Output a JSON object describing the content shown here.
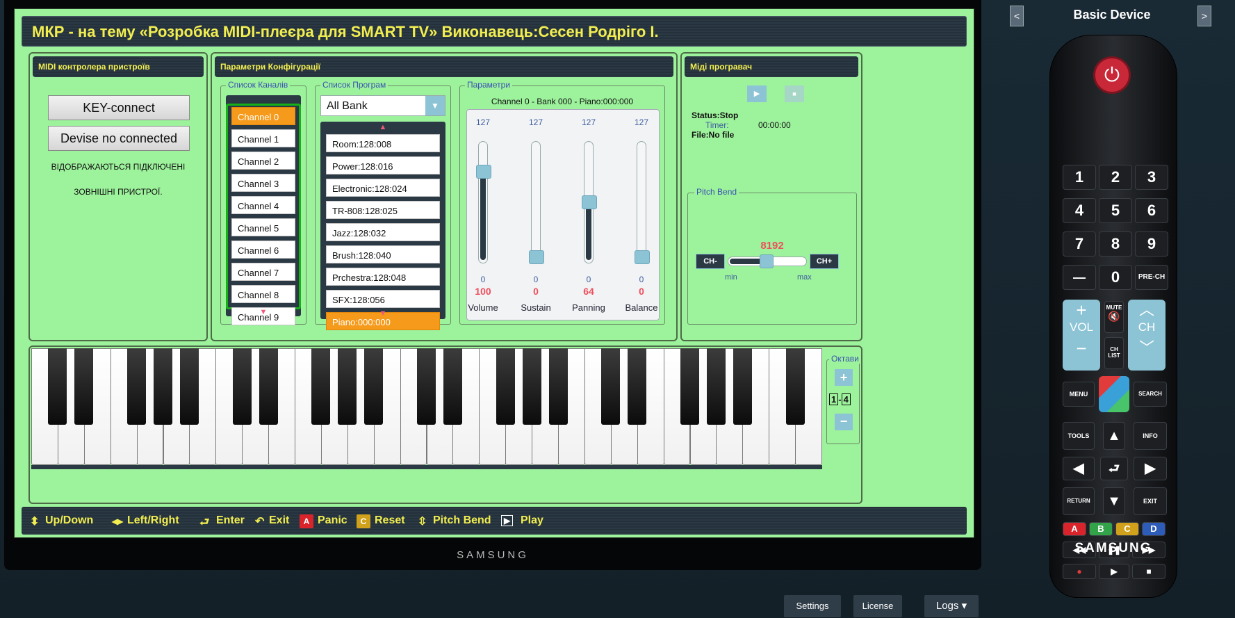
{
  "window": {
    "title": "МКР - на тему «Розробка MIDI-плеєра для SMART TV» Виконавець:Сесен Родріго І.",
    "brand": "SAMSUNG"
  },
  "midi_panel": {
    "heading": "MIDI контролера пристроїв",
    "key_connect": "KEY-connect",
    "device_status": "Devise no connected",
    "note_line1": "ВІДОБРАЖАЮТЬСЯ ПІДКЛЮЧЕНІ",
    "note_line2": "ЗОВНІШНІ ПРИСТРОЇ."
  },
  "config_panel": {
    "heading": "Параметри Конфігурації",
    "channels_legend": "Список Каналів",
    "channels": [
      "Channel 0",
      "Channel 1",
      "Channel 2",
      "Channel 3",
      "Channel 4",
      "Channel 5",
      "Channel 6",
      "Channel 7",
      "Channel 8",
      "Channel 9"
    ],
    "selected_channel": 0,
    "programs_legend": "Список Програм",
    "bank_select": "All Bank",
    "programs": [
      "Room:128:008",
      "Power:128:016",
      "Electronic:128:024",
      "TR-808:128:025",
      "Jazz:128:032",
      "Brush:128:040",
      "Prchestra:128:048",
      "SFX:128:056",
      "Piano:000:000"
    ],
    "selected_program": 8,
    "params_legend": "Параметри",
    "params_info": "Channel 0 - Bank 000 - Piano:000:000",
    "sliders": [
      {
        "label": "Volume",
        "max": "127",
        "min": "0",
        "value": "100",
        "fraction": 0.787
      },
      {
        "label": "Sustain",
        "max": "127",
        "min": "0",
        "value": "0",
        "fraction": 0
      },
      {
        "label": "Panning",
        "max": "127",
        "min": "0",
        "value": "64",
        "fraction": 0.504
      },
      {
        "label": "Balance",
        "max": "127",
        "min": "0",
        "value": "0",
        "fraction": 0
      }
    ]
  },
  "player_panel": {
    "heading": "Міді програвач",
    "status": "Status:Stop",
    "timer_label": "Timer:",
    "timer_value": "00:00:00",
    "file": "File:No file",
    "pitch_legend": "Pitch Bend",
    "pitch_value": "8192",
    "pitch_fraction": 0.5,
    "ch_minus": "CH-",
    "ch_plus": "CH+",
    "min_label": "min",
    "max_label": "max"
  },
  "octaves": {
    "legend": "Октави",
    "from": "1",
    "to": "4",
    "sep": "-"
  },
  "help_bar": {
    "updown": "Up/Down",
    "leftright": "Left/Right",
    "enter": "Enter",
    "exit": "Exit",
    "panic_key": "A",
    "panic": "Panic",
    "reset_key": "C",
    "reset": "Reset",
    "pitch": "Pitch Bend",
    "play": "Play"
  },
  "remote": {
    "device_title": "Basic Device",
    "digits": [
      "1",
      "2",
      "3",
      "4",
      "5",
      "6",
      "7",
      "8",
      "9"
    ],
    "dash": "—",
    "zero": "0",
    "prech": "PRE-CH",
    "vol": "VOL",
    "ch": "CH",
    "mute": "MUTE",
    "chlist": "CH LIST",
    "menu": "MENU",
    "search": "SEARCH",
    "tools": "TOOLS",
    "info": "INFO",
    "return": "RETURN",
    "exit": "EXIT",
    "color_a": "A",
    "color_b": "B",
    "color_c": "C",
    "color_d": "D",
    "brand": "SAMSUNG"
  },
  "footer": {
    "settings": "Settings",
    "license": "License",
    "logs": "Logs ▾"
  },
  "colors": {
    "screen_bg": "#9df29c",
    "title_yellow": "#f2ee50",
    "accent_orange": "#f59a1a",
    "value_red": "#ef4e5d"
  }
}
